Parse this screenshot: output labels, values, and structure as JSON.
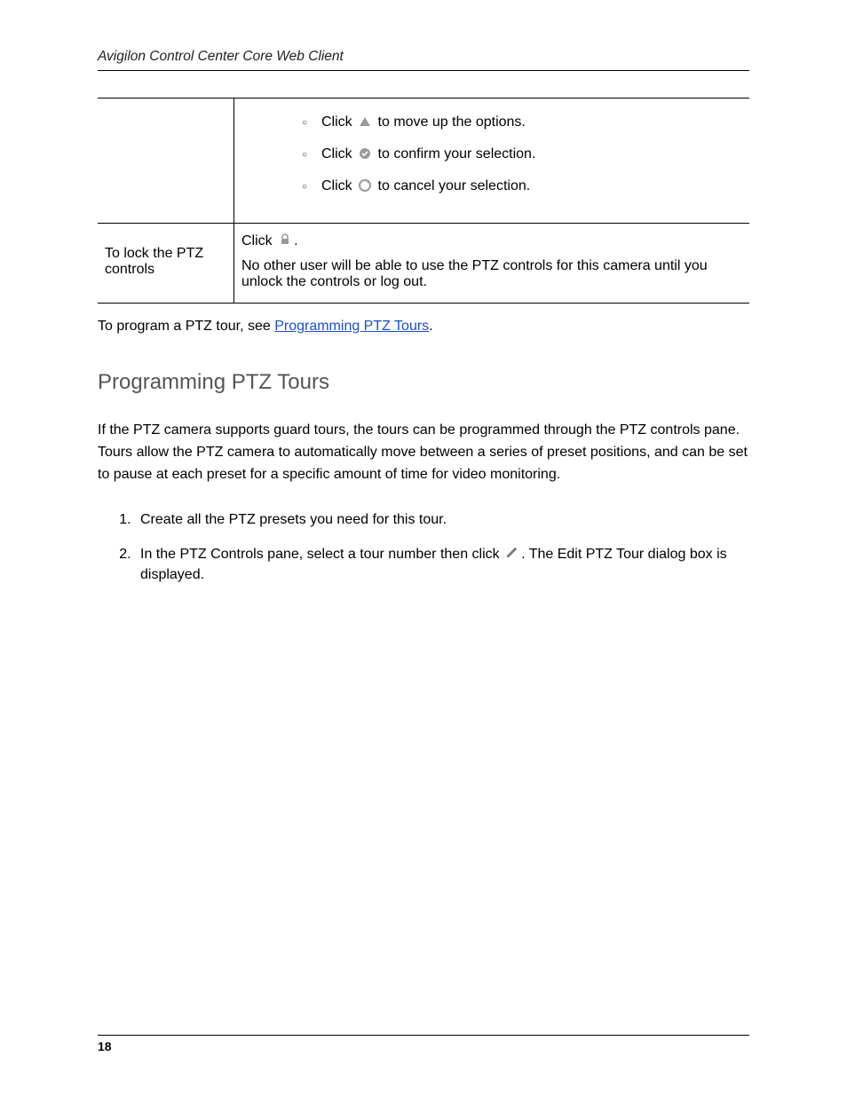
{
  "header": "Avigilon Control Center Core Web Client",
  "table": {
    "row1": {
      "item1a": "Click",
      "item1b": "to move up the options.",
      "item2a": "Click",
      "item2b": "to confirm your selection.",
      "item3a": "Click",
      "item3b": "to cancel your selection."
    },
    "row2": {
      "left": "To lock the PTZ controls",
      "rightClick": "Click",
      "rightDot": ".",
      "rightBody": "No other user will be able to use the PTZ controls for this camera until you unlock the controls or log out."
    }
  },
  "afterTable": {
    "pre": "To program a PTZ tour, see ",
    "link": "Programming PTZ Tours",
    "post": "."
  },
  "sectionHeading": "Programming PTZ Tours",
  "intro": "If the PTZ camera supports guard tours, the tours can be programmed through the PTZ controls pane. Tours allow the PTZ camera to automatically move between a series of preset positions, and can be set to pause at each preset for a specific amount of time for video monitoring.",
  "steps": {
    "s1": "Create all the PTZ presets you need for this tour.",
    "s2a": "In the PTZ Controls pane, select a tour number then click ",
    "s2b": ". The Edit PTZ Tour dialog box is displayed."
  },
  "pageNumber": "18"
}
